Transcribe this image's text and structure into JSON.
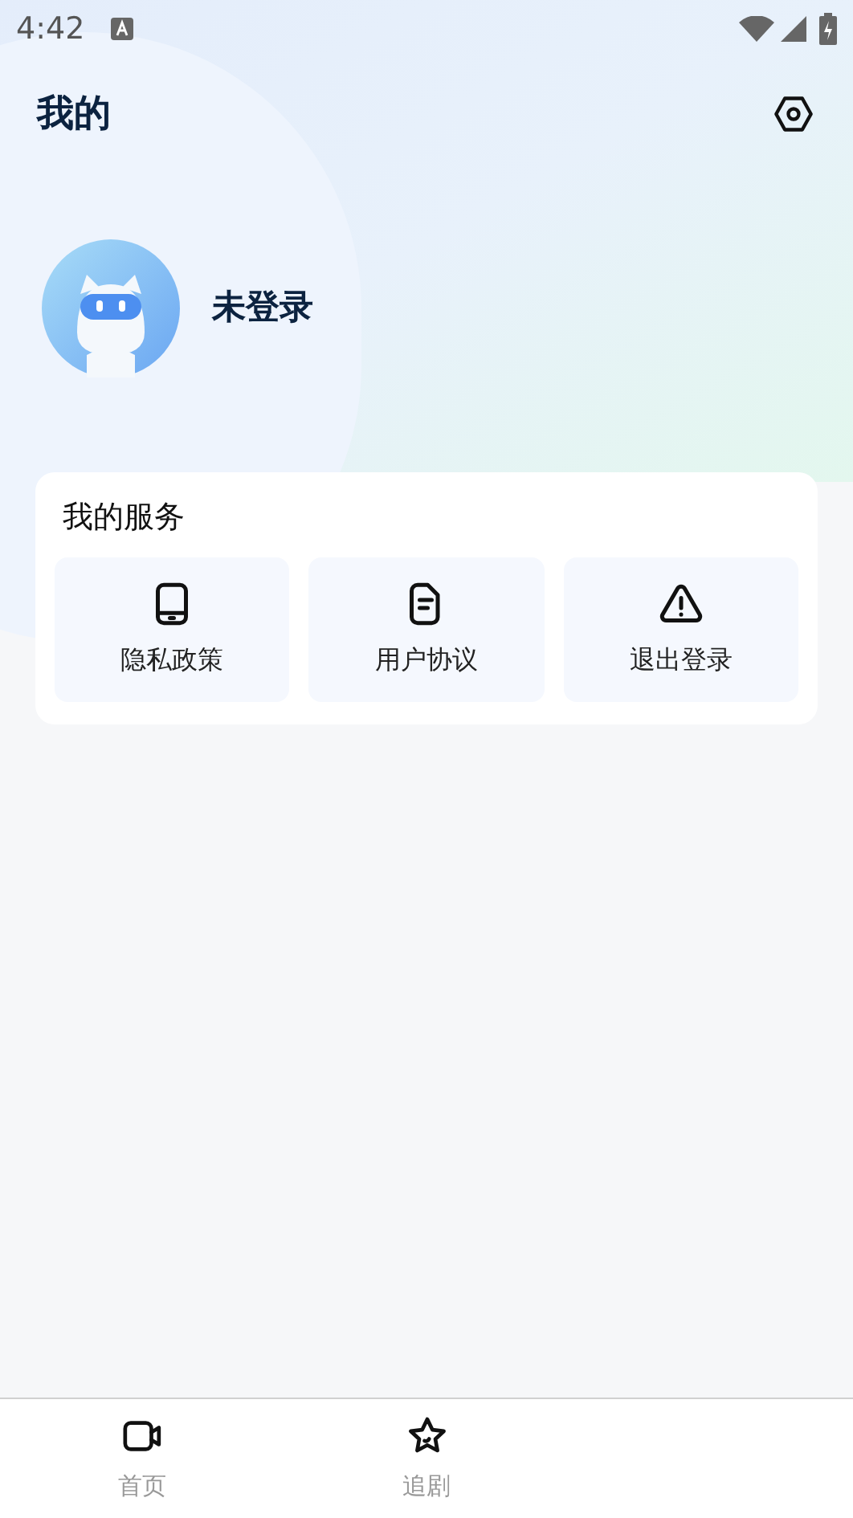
{
  "status_bar": {
    "time": "4:42"
  },
  "header": {
    "title": "我的"
  },
  "profile": {
    "name": "未登录"
  },
  "services": {
    "title": "我的服务",
    "items": [
      {
        "kind": "phone",
        "label": "隐私政策"
      },
      {
        "kind": "document",
        "label": "用户协议"
      },
      {
        "kind": "warning",
        "label": "退出登录"
      }
    ]
  },
  "bottom_nav": [
    {
      "kind": "video",
      "label": "首页",
      "selected": false
    },
    {
      "kind": "star",
      "label": "追剧",
      "selected": false
    }
  ]
}
